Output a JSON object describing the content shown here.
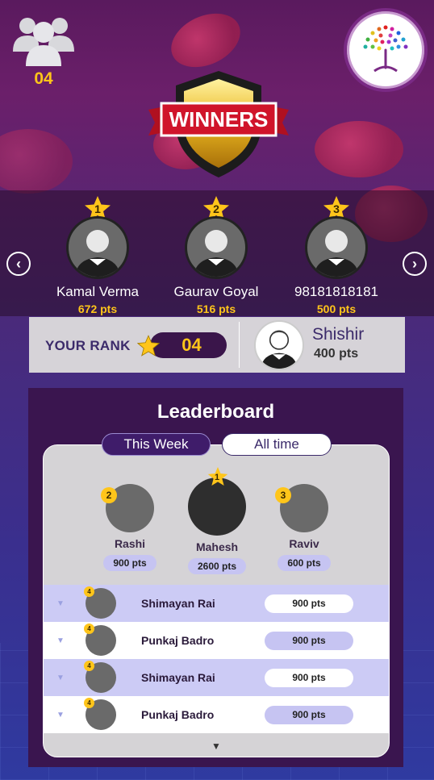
{
  "header": {
    "members_count": "04",
    "banner_text": "WINNERS"
  },
  "podium": [
    {
      "rank": "1",
      "name": "Kamal Verma",
      "points": "672 pts"
    },
    {
      "rank": "2",
      "name": "Gaurav Goyal",
      "points": "516 pts"
    },
    {
      "rank": "3",
      "name": "98181818181",
      "points": "500 pts"
    }
  ],
  "your_rank": {
    "label": "YOUR RANK",
    "rank": "04",
    "user_name": "Shishir",
    "user_points": "400 pts"
  },
  "leaderboard": {
    "title": "Leaderboard",
    "tabs": [
      {
        "label": "This Week",
        "active": true
      },
      {
        "label": "All time",
        "active": false
      }
    ],
    "top3": [
      {
        "rank": "2",
        "name": "Rashi",
        "points": "900 pts"
      },
      {
        "rank": "1",
        "name": "Mahesh",
        "points": "2600 pts"
      },
      {
        "rank": "3",
        "name": "Raviv",
        "points": "600 pts"
      }
    ],
    "rows": [
      {
        "rank": "4",
        "name": "Shimayan Rai",
        "points": "900 pts"
      },
      {
        "rank": "4",
        "name": "Punkaj Badro",
        "points": "900 pts"
      },
      {
        "rank": "4",
        "name": "Shimayan Rai",
        "points": "900 pts"
      },
      {
        "rank": "4",
        "name": "Punkaj Badro",
        "points": "900 pts"
      }
    ]
  },
  "colors": {
    "accent_gold": "#ffc51a",
    "panel_purple": "#3a154f",
    "row_lavender": "#cccbf5"
  },
  "icons": [
    "group-icon",
    "logo-tree-icon",
    "shield-banner-icon",
    "star-icon",
    "chevron-left-icon",
    "chevron-right-icon",
    "chevron-down-icon",
    "user-avatar-icon"
  ]
}
